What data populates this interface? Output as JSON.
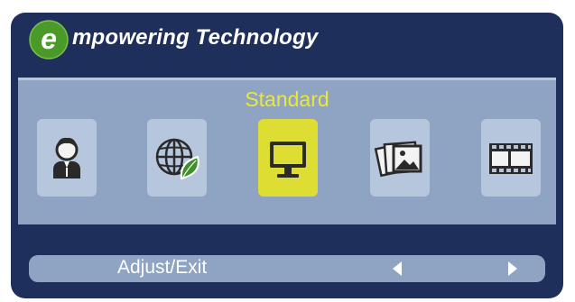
{
  "header": {
    "logo_letter": "e",
    "brand_text": "mpowering Technology"
  },
  "mode": {
    "selected_label": "Standard",
    "icons": [
      {
        "name": "user-icon",
        "selected": false
      },
      {
        "name": "eco-globe-icon",
        "selected": false
      },
      {
        "name": "monitor-icon",
        "selected": true
      },
      {
        "name": "photos-icon",
        "selected": false
      },
      {
        "name": "film-icon",
        "selected": false
      }
    ]
  },
  "footer": {
    "adjust_label": "Adjust/Exit"
  },
  "colors": {
    "background": "#1d2f5a",
    "panel": "#8ea4c2",
    "icon_tile": "#b6c7dd",
    "selected_tile": "#dedd33",
    "selected_text": "#e9e83a",
    "logo_green": "#4a9a2a"
  }
}
